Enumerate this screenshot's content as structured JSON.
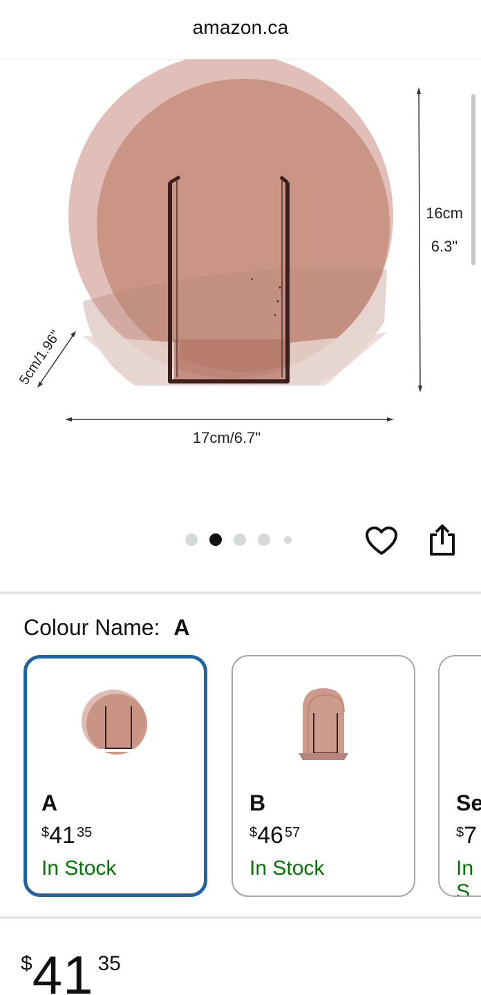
{
  "browser": {
    "url": "amazon.ca"
  },
  "gallery": {
    "image_alt": "Rose tinted acrylic round vase with dimensions",
    "dimensions": {
      "height_cm": "16cm",
      "height_in": "6.3\"",
      "width": "17cm/6.7\"",
      "depth": "5cm/1.96\""
    },
    "dots_total": 5,
    "active_dot": 2,
    "icons": {
      "wishlist": "heart-icon",
      "share": "share-icon"
    }
  },
  "variation": {
    "label": "Colour Name:",
    "selected": "A",
    "options": [
      {
        "name": "A",
        "price_symbol": "$",
        "price_whole": "41",
        "price_fraction": "35",
        "stock": "In Stock",
        "selected": true
      },
      {
        "name": "B",
        "price_symbol": "$",
        "price_whole": "46",
        "price_fraction": "57",
        "stock": "In Stock",
        "selected": false
      },
      {
        "name": "Se",
        "price_symbol": "$",
        "price_whole": "7",
        "price_fraction": "",
        "stock": "In S",
        "selected": false
      }
    ]
  },
  "buybox": {
    "price_symbol": "$",
    "price_whole": "41",
    "price_fraction": "35"
  },
  "colors": {
    "selected_border": "#2162a1",
    "in_stock": "#007600",
    "vase_tint": "#c48f82"
  }
}
